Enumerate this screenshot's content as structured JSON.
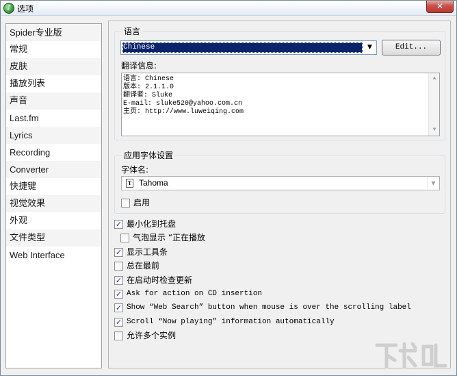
{
  "window": {
    "title": "选项",
    "close_glyph": "✕"
  },
  "sidebar": {
    "items": [
      {
        "label": "Spider专业版"
      },
      {
        "label": "常规"
      },
      {
        "label": "皮肤"
      },
      {
        "label": "播放列表"
      },
      {
        "label": "声音"
      },
      {
        "label": "Last.fm"
      },
      {
        "label": "Lyrics"
      },
      {
        "label": "Recording"
      },
      {
        "label": "Converter"
      },
      {
        "label": "快捷键"
      },
      {
        "label": "视觉效果"
      },
      {
        "label": "外观"
      },
      {
        "label": "文件类型"
      },
      {
        "label": "Web Interface"
      }
    ]
  },
  "language": {
    "group_title": "语言",
    "selected": "Chinese",
    "edit_label": "Edit...",
    "info_label": "翻译信息:",
    "info_lines": [
      "语言: Chinese",
      "版本: 2.1.1.0",
      "翻译者: Sluke",
      "E-mail: sluke520@yahoo.com.cn",
      "主页: http://www.luweiqing.com"
    ]
  },
  "font": {
    "group_title": "应用字体设置",
    "name_label": "字体名:",
    "name_value": "Tahoma",
    "enable_label": "启用",
    "enable_checked": false
  },
  "options": [
    {
      "label": "最小化到托盘",
      "checked": true,
      "indent": false,
      "mono": false
    },
    {
      "label": "气泡显示 “正在播放",
      "checked": false,
      "indent": true,
      "mono": false
    },
    {
      "label": "显示工具条",
      "checked": true,
      "indent": false,
      "mono": false
    },
    {
      "label": "总在最前",
      "checked": false,
      "indent": false,
      "mono": false
    },
    {
      "label": "在启动时检查更新",
      "checked": true,
      "indent": false,
      "mono": false
    },
    {
      "label": "Ask for action on CD insertion",
      "checked": true,
      "indent": false,
      "mono": true
    },
    {
      "label": "Show “Web Search” button when mouse is over the scrolling label",
      "checked": true,
      "indent": false,
      "mono": true
    },
    {
      "label": "Scroll “Now playing” information automatically",
      "checked": true,
      "indent": false,
      "mono": true
    },
    {
      "label": "允许多个实例",
      "checked": false,
      "indent": false,
      "mono": false
    }
  ],
  "watermark": {
    "text": "下载吧"
  },
  "colors": {
    "selection": "#0a246a",
    "check": "#21439c",
    "close": "#c75050"
  }
}
